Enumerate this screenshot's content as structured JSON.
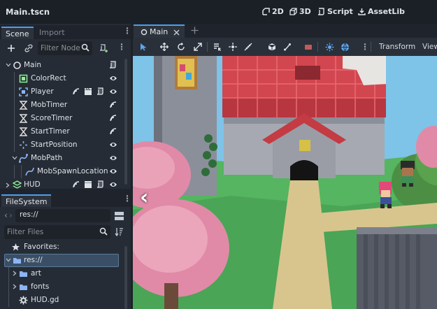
{
  "window": {
    "title": "Main.tscn"
  },
  "workspaces": [
    {
      "label": "2D",
      "icon": "2d-icon"
    },
    {
      "label": "3D",
      "icon": "3d-icon"
    },
    {
      "label": "Script",
      "icon": "script-icon"
    },
    {
      "label": "AssetLib",
      "icon": "assetlib-icon"
    }
  ],
  "scene_dock": {
    "tabs": [
      "Scene",
      "Import"
    ],
    "filter_placeholder": "Filter Nodes",
    "tree": [
      {
        "label": "Main",
        "icon": "node-icon"
      },
      {
        "label": "ColorRect",
        "icon": "colorrect-icon"
      },
      {
        "label": "Player",
        "icon": "area2d-icon"
      },
      {
        "label": "MobTimer",
        "icon": "timer-icon"
      },
      {
        "label": "ScoreTimer",
        "icon": "timer-icon"
      },
      {
        "label": "StartTimer",
        "icon": "timer-icon"
      },
      {
        "label": "StartPosition",
        "icon": "marker2d-icon"
      },
      {
        "label": "MobPath",
        "icon": "path2d-icon"
      },
      {
        "label": "MobSpawnLocation",
        "icon": "pathfollow2d-icon"
      },
      {
        "label": "HUD",
        "icon": "canvaslayer-icon"
      }
    ]
  },
  "filesystem_dock": {
    "tab": "FileSystem",
    "path": "res://",
    "filter_placeholder": "Filter Files",
    "items": [
      {
        "label": "Favorites:",
        "icon": "star-icon"
      },
      {
        "label": "res://",
        "icon": "folder-icon"
      },
      {
        "label": "art",
        "icon": "folder-icon"
      },
      {
        "label": "fonts",
        "icon": "folder-icon"
      },
      {
        "label": "HUD.gd",
        "icon": "gear-file-icon"
      }
    ]
  },
  "editor": {
    "scene_tab": "Main",
    "toolbar": {
      "transform_label": "Transform",
      "view_label": "View"
    }
  },
  "colors": {
    "accent": "#4b9ef0",
    "selection": "#3a4f66",
    "background": "#1d2229",
    "dock": "#262c35"
  }
}
